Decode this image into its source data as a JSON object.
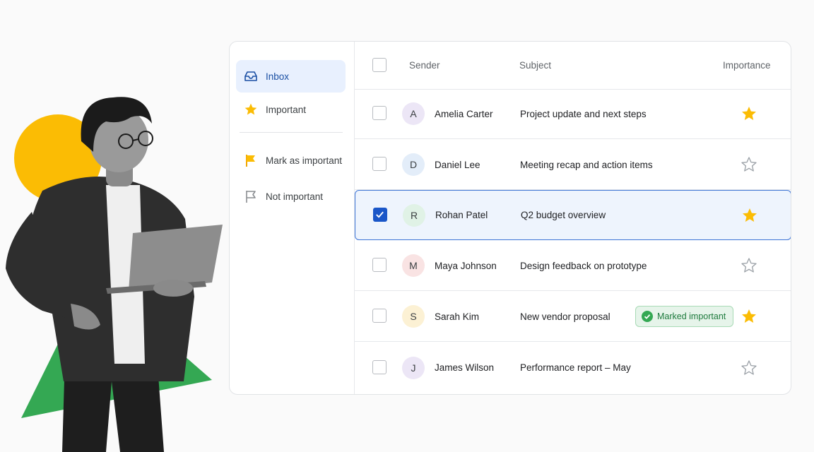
{
  "colors": {
    "accent": "#1a56c8",
    "selected_bg": "#eef4fd",
    "star": "#fbbc04",
    "badge_bg": "#e6f4ea",
    "badge_text": "#1e7a3d",
    "deco_circle": "#fbbc04",
    "deco_triangle": "#34a853"
  },
  "sidebar": {
    "items": [
      {
        "label": "Inbox",
        "icon": "inbox-icon"
      },
      {
        "label": "Important",
        "icon": "star-icon"
      },
      {
        "label": "Mark as important",
        "icon": "flag-filled-icon"
      },
      {
        "label": "Not important",
        "icon": "flag-outline-icon"
      }
    ]
  },
  "table": {
    "headers": {
      "sender": "Sender",
      "subject": "Subject",
      "importance": "Importance"
    },
    "rows": [
      {
        "initial": "A",
        "sender": "Amelia Carter",
        "subject": "Project update and next steps",
        "important": true,
        "checked": false,
        "avatar_color": "#ece6f6"
      },
      {
        "initial": "D",
        "sender": "Daniel Lee",
        "subject": "Meeting recap and action items",
        "important": false,
        "checked": false,
        "avatar_color": "#e3edf9"
      },
      {
        "initial": "R",
        "sender": "Rohan Patel",
        "subject": "Q2 budget overview",
        "important": true,
        "checked": true,
        "avatar_color": "#e0f2e6"
      },
      {
        "initial": "M",
        "sender": "Maya Johnson",
        "subject": "Design feedback on prototype",
        "important": false,
        "checked": false,
        "avatar_color": "#f9e3e3"
      },
      {
        "initial": "S",
        "sender": "Sarah Kim",
        "subject": "New vendor proposal",
        "important": true,
        "checked": false,
        "avatar_color": "#fcf1d4",
        "badge": "Marked important"
      },
      {
        "initial": "J",
        "sender": "James Wilson",
        "subject": "Performance report – May",
        "important": false,
        "checked": false,
        "avatar_color": "#ece6f6"
      }
    ]
  }
}
